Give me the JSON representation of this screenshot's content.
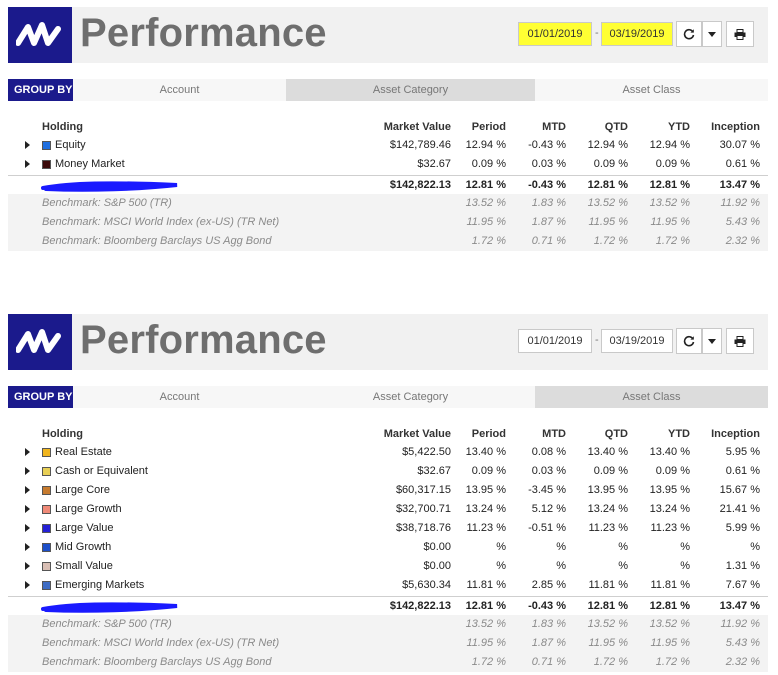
{
  "panels": [
    {
      "title": "Performance",
      "start_date": "01/01/2019",
      "end_date": "03/19/2019",
      "date_separator": "-",
      "highlight_dates": true,
      "group_by_label": "GROUP BY",
      "group_tabs": [
        "Account",
        "Asset Category",
        "Asset Class"
      ],
      "active_tab": "Asset Category",
      "columns": [
        "Holding",
        "Market Value",
        "Period",
        "MTD",
        "QTD",
        "YTD",
        "Inception"
      ],
      "rows": [
        {
          "name": "Equity",
          "color": "#1f6fe0",
          "market_value": "$142,789.46",
          "period": "12.94 %",
          "mtd": "-0.43 %",
          "qtd": "12.94 %",
          "ytd": "12.94 %",
          "inception": "30.07 %"
        },
        {
          "name": "Money Market",
          "color": "#3b0a0a",
          "market_value": "$32.67",
          "period": "0.09 %",
          "mtd": "0.03 %",
          "qtd": "0.09 %",
          "ytd": "0.09 %",
          "inception": "0.61 %"
        }
      ],
      "total": {
        "market_value": "$142,822.13",
        "period": "12.81 %",
        "mtd": "-0.43 %",
        "qtd": "12.81 %",
        "ytd": "12.81 %",
        "inception": "13.47 %"
      },
      "benchmarks": [
        {
          "name": "Benchmark: S&P 500 (TR)",
          "period": "13.52 %",
          "mtd": "1.83 %",
          "qtd": "13.52 %",
          "ytd": "13.52 %",
          "inception": "11.92 %"
        },
        {
          "name": "Benchmark: MSCI World Index (ex-US) (TR Net)",
          "period": "11.95 %",
          "mtd": "1.87 %",
          "qtd": "11.95 %",
          "ytd": "11.95 %",
          "inception": "5.43 %"
        },
        {
          "name": "Benchmark: Bloomberg Barclays US Agg Bond",
          "period": "1.72 %",
          "mtd": "0.71 %",
          "qtd": "1.72 %",
          "ytd": "1.72 %",
          "inception": "2.32 %"
        }
      ]
    },
    {
      "title": "Performance",
      "start_date": "01/01/2019",
      "end_date": "03/19/2019",
      "date_separator": "-",
      "highlight_dates": false,
      "group_by_label": "GROUP BY",
      "group_tabs": [
        "Account",
        "Asset Category",
        "Asset Class"
      ],
      "active_tab": "Asset Class",
      "columns": [
        "Holding",
        "Market Value",
        "Period",
        "MTD",
        "QTD",
        "YTD",
        "Inception"
      ],
      "rows": [
        {
          "name": "Real Estate",
          "color": "#f0b51e",
          "market_value": "$5,422.50",
          "period": "13.40 %",
          "mtd": "0.08 %",
          "qtd": "13.40 %",
          "ytd": "13.40 %",
          "inception": "5.95 %"
        },
        {
          "name": "Cash or Equivalent",
          "color": "#e8cf55",
          "market_value": "$32.67",
          "period": "0.09 %",
          "mtd": "0.03 %",
          "qtd": "0.09 %",
          "ytd": "0.09 %",
          "inception": "0.61 %"
        },
        {
          "name": "Large Core",
          "color": "#c77b2e",
          "market_value": "$60,317.15",
          "period": "13.95 %",
          "mtd": "-3.45 %",
          "qtd": "13.95 %",
          "ytd": "13.95 %",
          "inception": "15.67 %"
        },
        {
          "name": "Large Growth",
          "color": "#f08a78",
          "market_value": "$32,700.71",
          "period": "13.24 %",
          "mtd": "5.12 %",
          "qtd": "13.24 %",
          "ytd": "13.24 %",
          "inception": "21.41 %"
        },
        {
          "name": "Large Value",
          "color": "#2420d6",
          "market_value": "$38,718.76",
          "period": "11.23 %",
          "mtd": "-0.51 %",
          "qtd": "11.23 %",
          "ytd": "11.23 %",
          "inception": "5.99 %"
        },
        {
          "name": "Mid Growth",
          "color": "#1d4fc9",
          "market_value": "$0.00",
          "period": "%",
          "mtd": "%",
          "qtd": "%",
          "ytd": "%",
          "inception": "%"
        },
        {
          "name": "Small Value",
          "color": "#d9bfb5",
          "market_value": "$0.00",
          "period": "%",
          "mtd": "%",
          "qtd": "%",
          "ytd": "%",
          "inception": "1.31 %"
        },
        {
          "name": "Emerging Markets",
          "color": "#3e6cc4",
          "market_value": "$5,630.34",
          "period": "11.81 %",
          "mtd": "2.85 %",
          "qtd": "11.81 %",
          "ytd": "11.81 %",
          "inception": "7.67 %"
        }
      ],
      "total": {
        "market_value": "$142,822.13",
        "period": "12.81 %",
        "mtd": "-0.43 %",
        "qtd": "12.81 %",
        "ytd": "12.81 %",
        "inception": "13.47 %"
      },
      "benchmarks": [
        {
          "name": "Benchmark: S&P 500 (TR)",
          "period": "13.52 %",
          "mtd": "1.83 %",
          "qtd": "13.52 %",
          "ytd": "13.52 %",
          "inception": "11.92 %"
        },
        {
          "name": "Benchmark: MSCI World Index (ex-US) (TR Net)",
          "period": "11.95 %",
          "mtd": "1.87 %",
          "qtd": "11.95 %",
          "ytd": "11.95 %",
          "inception": "5.43 %"
        },
        {
          "name": "Benchmark: Bloomberg Barclays US Agg Bond",
          "period": "1.72 %",
          "mtd": "0.71 %",
          "qtd": "1.72 %",
          "ytd": "1.72 %",
          "inception": "2.32 %"
        }
      ]
    }
  ],
  "colors": {
    "brand": "#1b1a8c",
    "highlight": "#ffff33",
    "redaction": "#1a1aff"
  },
  "icons": {
    "logo": "wave-logo-icon",
    "refresh": "refresh-icon",
    "dropdown": "chevron-down-icon",
    "print": "print-icon"
  }
}
